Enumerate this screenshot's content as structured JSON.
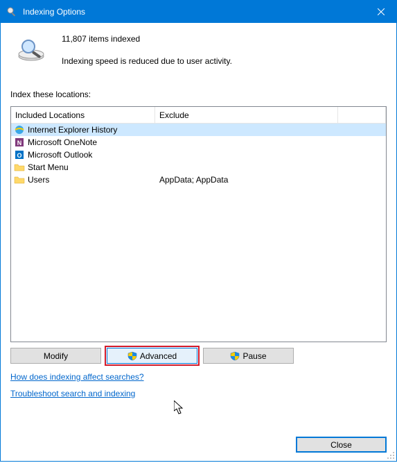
{
  "window": {
    "title": "Indexing Options"
  },
  "status": {
    "count_line": "11,807 items indexed",
    "speed_line": "Indexing speed is reduced due to user activity."
  },
  "index_locations_label": "Index these locations:",
  "columns": {
    "included": "Included Locations",
    "exclude": "Exclude"
  },
  "rows": [
    {
      "icon": "ie",
      "location": "Internet Explorer History",
      "exclude": "",
      "selected": true
    },
    {
      "icon": "onenote",
      "location": "Microsoft OneNote",
      "exclude": "",
      "selected": false
    },
    {
      "icon": "outlook",
      "location": "Microsoft Outlook",
      "exclude": "",
      "selected": false
    },
    {
      "icon": "folder",
      "location": "Start Menu",
      "exclude": "",
      "selected": false
    },
    {
      "icon": "folder",
      "location": "Users",
      "exclude": "AppData; AppData",
      "selected": false
    }
  ],
  "buttons": {
    "modify": "Modify",
    "advanced": "Advanced",
    "pause": "Pause",
    "close": "Close"
  },
  "links": {
    "how": "How does indexing affect searches?",
    "troubleshoot": "Troubleshoot search and indexing"
  }
}
